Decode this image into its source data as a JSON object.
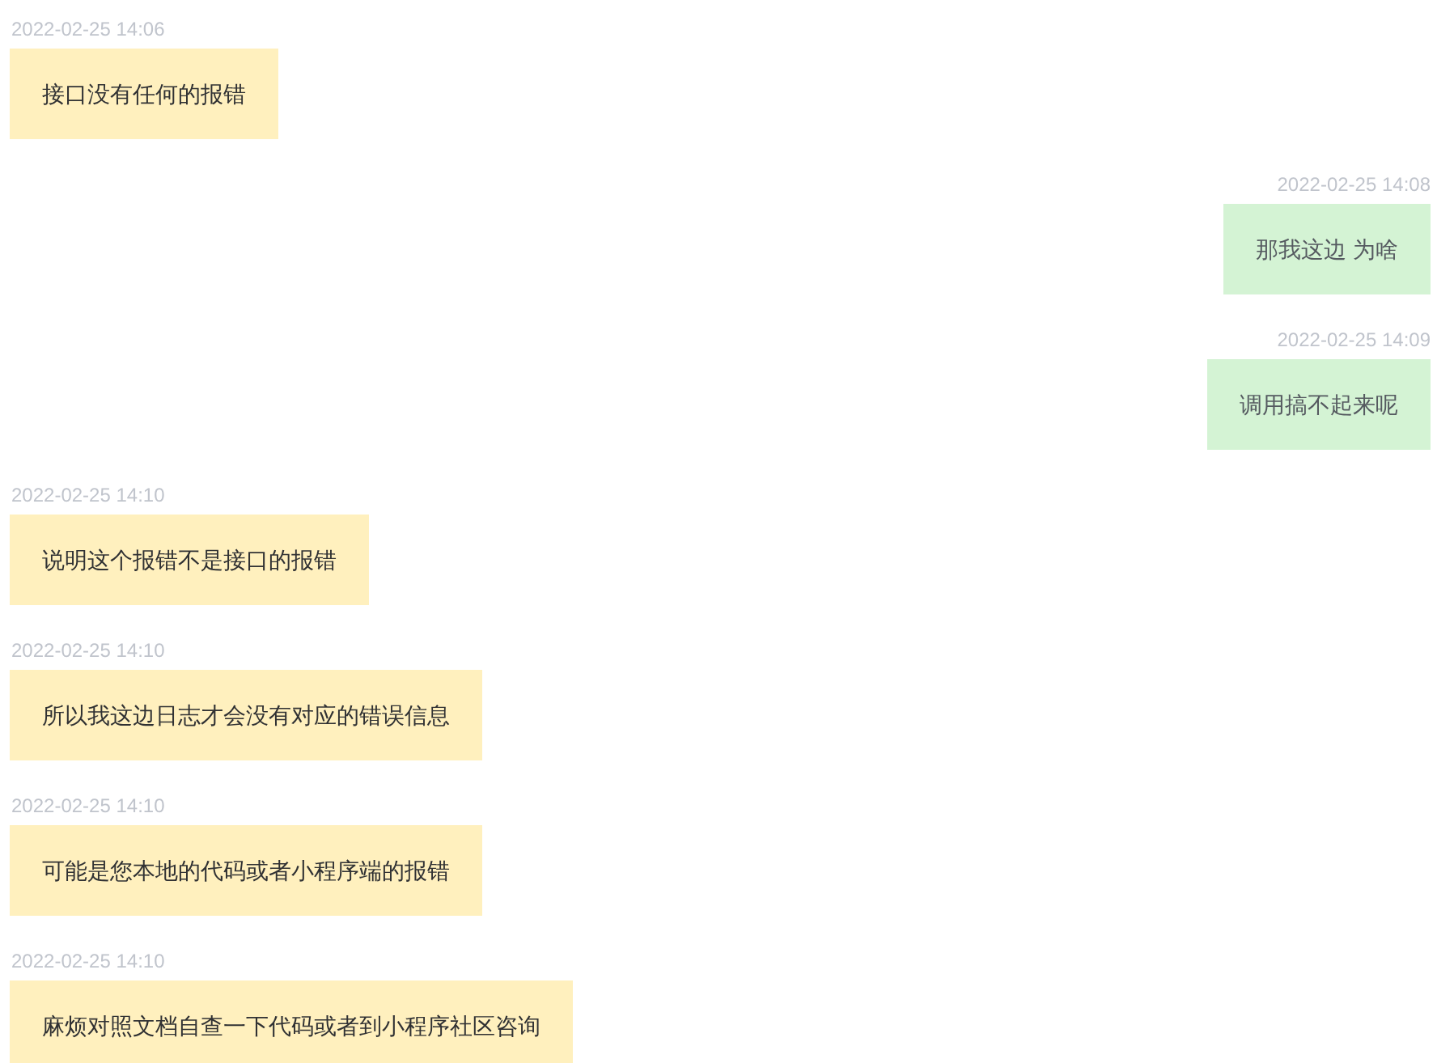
{
  "messages": [
    {
      "kind": "received",
      "time": "2022-02-25 14:06",
      "text": "接口没有任何的报错"
    },
    {
      "kind": "sent",
      "time": "2022-02-25 14:08",
      "text": "那我这边 为啥"
    },
    {
      "kind": "sent",
      "time": "2022-02-25 14:09",
      "text": "调用搞不起来呢"
    },
    {
      "kind": "received",
      "time": "2022-02-25 14:10",
      "text": "说明这个报错不是接口的报错"
    },
    {
      "kind": "received",
      "time": "2022-02-25 14:10",
      "text": "所以我这边日志才会没有对应的错误信息"
    },
    {
      "kind": "received",
      "time": "2022-02-25 14:10",
      "text": "可能是您本地的代码或者小程序端的报错"
    },
    {
      "kind": "received",
      "time": "2022-02-25 14:10",
      "text": "麻烦对照文档自查一下代码或者到小程序社区咨询"
    }
  ]
}
